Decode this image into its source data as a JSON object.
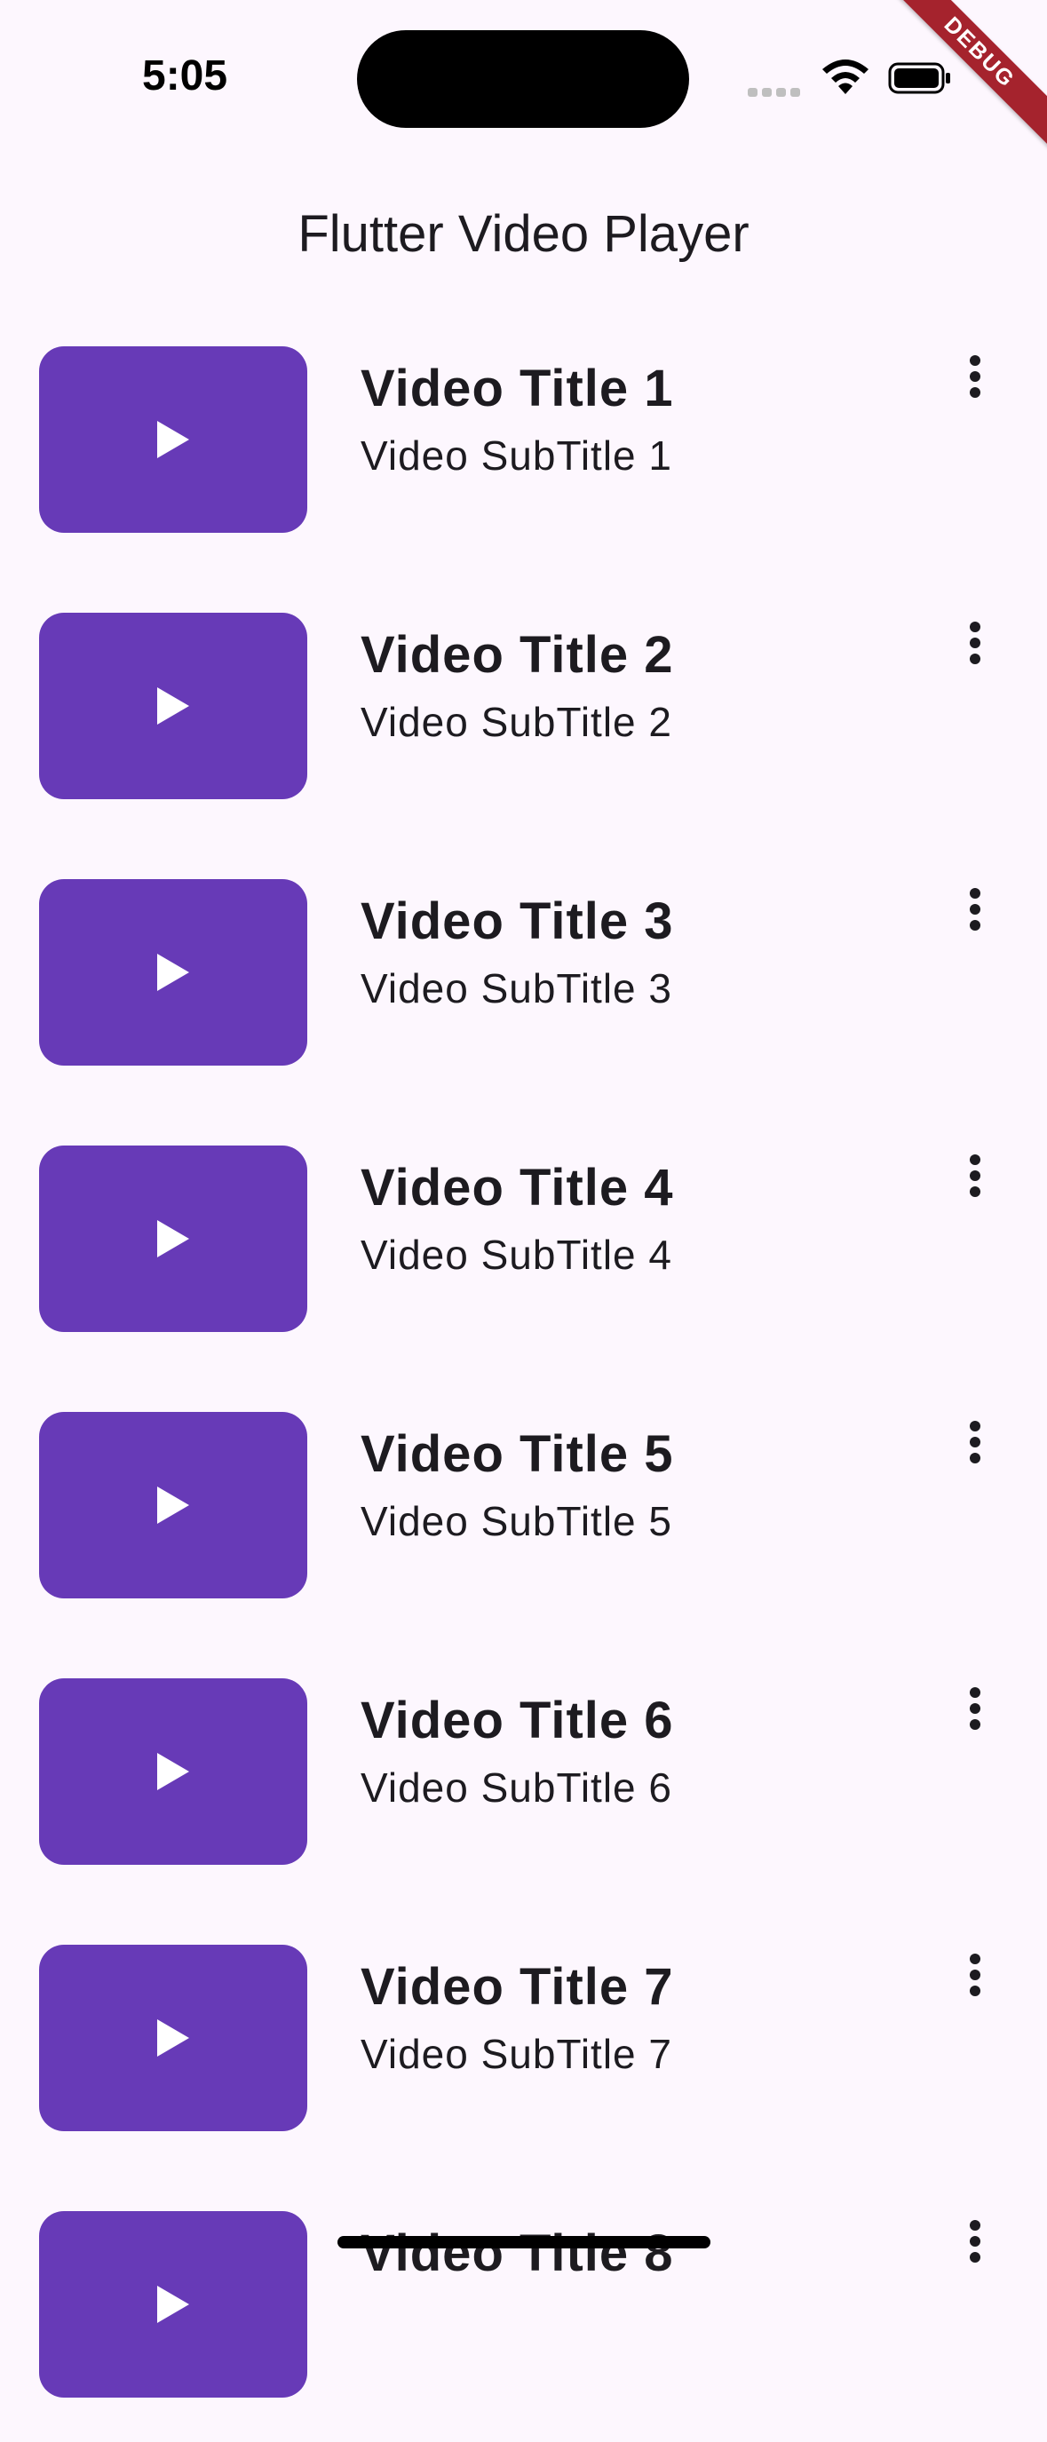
{
  "status_bar": {
    "time": "5:05",
    "signal_icon": "cellular-signal-icon",
    "wifi_icon": "wifi-icon",
    "battery_icon": "battery-icon"
  },
  "debug_banner": "DEBUG",
  "app_bar": {
    "title": "Flutter Video Player"
  },
  "videos": [
    {
      "title": "Video Title 1",
      "subtitle": "Video SubTitle 1"
    },
    {
      "title": "Video Title 2",
      "subtitle": "Video SubTitle 2"
    },
    {
      "title": "Video Title 3",
      "subtitle": "Video SubTitle 3"
    },
    {
      "title": "Video Title 4",
      "subtitle": "Video SubTitle 4"
    },
    {
      "title": "Video Title 5",
      "subtitle": "Video SubTitle 5"
    },
    {
      "title": "Video Title 6",
      "subtitle": "Video SubTitle 6"
    },
    {
      "title": "Video Title 7",
      "subtitle": "Video SubTitle 7"
    },
    {
      "title": "Video Title 8",
      "subtitle": ""
    }
  ],
  "icons": {
    "thumbnail": "play-icon",
    "menu": "more-vert-icon"
  },
  "colors": {
    "background": "#fdf7fe",
    "thumbnail": "#673ab7",
    "debug": "#a5232d"
  }
}
